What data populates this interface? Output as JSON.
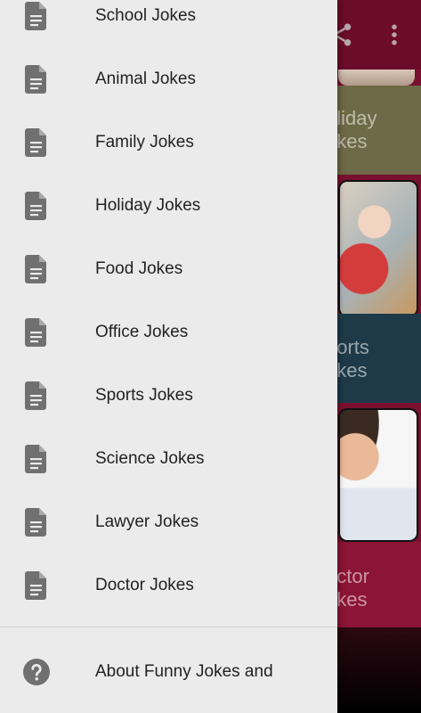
{
  "colors": {
    "drawer_bg": "#ebebeb",
    "icon_gray": "#707070",
    "label_text": "#222222",
    "toolbar_bg": "#6a0c2a"
  },
  "background": {
    "tiles": [
      {
        "label": "Holiday Jokes",
        "visible_text": "oliday\nokes"
      },
      {
        "label": "Sports Jokes",
        "visible_text": "ports\nokes"
      },
      {
        "label": "Doctor Jokes",
        "visible_text": "octor\nokes"
      }
    ],
    "toolbar_icons": [
      "share-icon",
      "more-vert-icon"
    ]
  },
  "drawer": {
    "items": [
      {
        "label": "School Jokes",
        "icon": "document-icon"
      },
      {
        "label": "Animal Jokes",
        "icon": "document-icon"
      },
      {
        "label": "Family Jokes",
        "icon": "document-icon"
      },
      {
        "label": "Holiday Jokes",
        "icon": "document-icon"
      },
      {
        "label": "Food Jokes",
        "icon": "document-icon"
      },
      {
        "label": "Office Jokes",
        "icon": "document-icon"
      },
      {
        "label": "Sports Jokes",
        "icon": "document-icon"
      },
      {
        "label": "Science Jokes",
        "icon": "document-icon"
      },
      {
        "label": "Lawyer Jokes",
        "icon": "document-icon"
      },
      {
        "label": "Doctor Jokes",
        "icon": "document-icon"
      }
    ],
    "about": {
      "label": "About Funny Jokes and",
      "icon": "help-icon"
    }
  }
}
